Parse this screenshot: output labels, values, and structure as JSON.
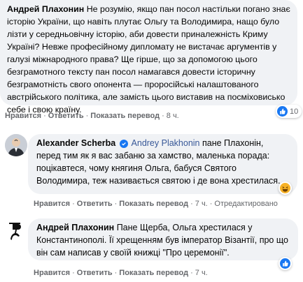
{
  "comments": [
    {
      "author": "Андрей Плахонин",
      "text": "Не розумію, якщо пан посол настільки погано знає історію України, що навіть плутає Ольгу та Володимира, нащо було лізти у середньовічну історію, аби довести приналежність Криму Україні? Невже професійному дипломату не вистачає аргументів у галузі міжнародного права? Ще гірше, що за допомогою цього безграмотного тексту пан посол намагався довести історичну безграмотність свого опонента — проросійські налаштованого австрійського політика, але замість цього виставив на посміховисько себе і свою країну.",
      "actions": {
        "like": "Нравится",
        "reply": "Ответить",
        "translate": "Показать перевод",
        "time": "8 ч."
      },
      "reactions": {
        "count": "10",
        "icon": "like-icon"
      }
    },
    {
      "author": "Alexander Scherba",
      "verified_icon": "verified-badge-icon",
      "mention": "Andrey Plakhonin",
      "text": "пане Плахонін, перед тим як я вас забаню за хамство, маленька порада: поцікавтеся, чому княгиня Ольга, бабуся Святого Володимира, теж називається святою і де вона хрестилася.",
      "actions": {
        "like": "Нравится",
        "reply": "Ответить",
        "translate": "Показать перевод",
        "time": "7 ч.",
        "edited": "Отредактировано"
      },
      "reactions": {
        "icon": "haha-icon"
      }
    },
    {
      "author": "Андрей Плахонин",
      "text": "Пане Щерба, Ольга хрестилася у Константинополі. Її хрещенням був імператор Візантії, про що він сам написав у своїй книжці \"Про церемонії\".",
      "actions": {
        "like": "Нравится",
        "reply": "Ответить",
        "translate": "Показать перевод",
        "time": "7 ч."
      },
      "reactions": {
        "icon": "like-icon"
      }
    }
  ],
  "colors": {
    "bubble": "#f0f2f5",
    "link": "#385898",
    "like": "#1877f2",
    "meta": "#65676b"
  }
}
